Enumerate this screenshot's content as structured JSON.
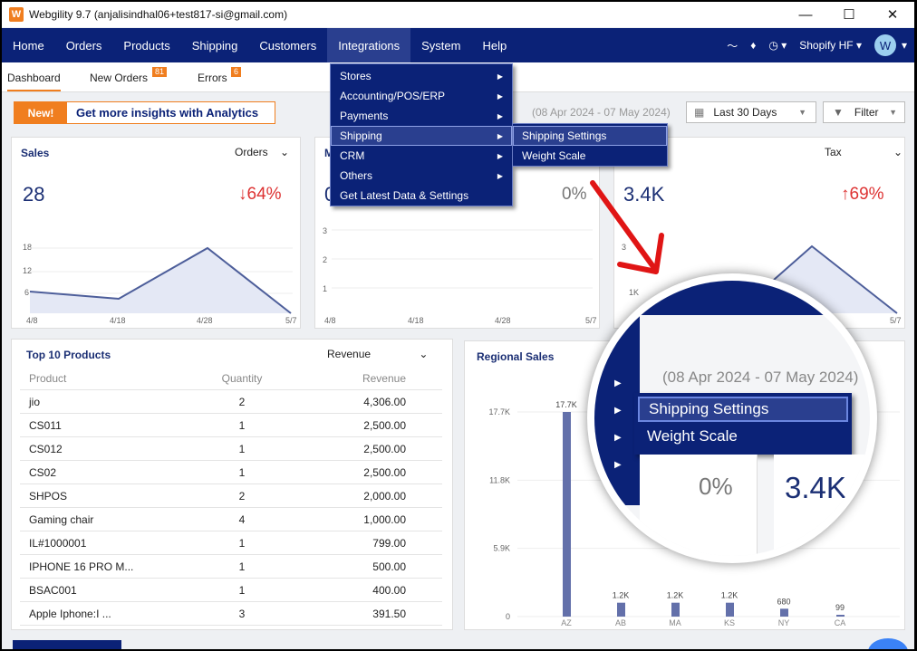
{
  "window": {
    "title": "Webgility 9.7 (anjalisindhal06+test817-si@gmail.com)",
    "logo_letter": "W"
  },
  "menubar": {
    "items": [
      "Home",
      "Orders",
      "Products",
      "Shipping",
      "Customers",
      "Integrations",
      "System",
      "Help"
    ],
    "store": "Shopify HF",
    "avatar": "W"
  },
  "tabs": {
    "dashboard": "Dashboard",
    "new_orders": "New Orders",
    "new_orders_count": "81",
    "errors": "Errors",
    "errors_count": "6"
  },
  "banner": {
    "new": "New!",
    "text": "Get more insights with Analytics"
  },
  "filters": {
    "range": "(08 Apr 2024 - 07 May 2024)",
    "period": "Last 30 Days",
    "filter": "Filter"
  },
  "integrations_menu": {
    "items": [
      "Stores",
      "Accounting/POS/ERP",
      "Payments",
      "Shipping",
      "CRM",
      "Others",
      "Get Latest Data & Settings"
    ]
  },
  "shipping_submenu": {
    "items": [
      "Shipping Settings",
      "Weight Scale"
    ]
  },
  "sales_card": {
    "title": "Sales",
    "dropdown": "Orders",
    "value": "28",
    "change": "64%",
    "yticks": [
      "18",
      "12",
      "6"
    ],
    "xticks": [
      "4/8",
      "4/18",
      "4/28",
      "5/7"
    ]
  },
  "mid_card": {
    "title_initial": "M",
    "value_initial": "0",
    "change": "0%",
    "yticks": [
      "3",
      "2",
      "1"
    ],
    "xticks": [
      "4/8",
      "4/18",
      "4/28",
      "5/7"
    ]
  },
  "tax_card": {
    "dropdown": "Tax",
    "value": "3.4K",
    "change": "69%",
    "yticks": [
      "3",
      "1K"
    ],
    "xticks": [
      "5/7"
    ]
  },
  "products": {
    "title": "Top 10 Products",
    "dropdown": "Revenue",
    "headers": [
      "Product",
      "Quantity",
      "Revenue"
    ],
    "rows": [
      [
        "jio",
        "2",
        "4,306.00"
      ],
      [
        "CS011",
        "1",
        "2,500.00"
      ],
      [
        "CS012",
        "1",
        "2,500.00"
      ],
      [
        "CS02",
        "1",
        "2,500.00"
      ],
      [
        "SHPOS",
        "2",
        "2,000.00"
      ],
      [
        "Gaming chair",
        "4",
        "1,000.00"
      ],
      [
        "IL#1000001",
        "1",
        "799.00"
      ],
      [
        "IPHONE 16 PRO M...",
        "1",
        "500.00"
      ],
      [
        "BSAC001",
        "1",
        "400.00"
      ],
      [
        "Apple Iphone:I ...",
        "3",
        "391.50"
      ]
    ]
  },
  "regional": {
    "title": "Regional Sales"
  },
  "magnifier": {
    "range": "(08 Apr 2024 - 07 May 2024)",
    "items": [
      "Shipping Settings",
      "Weight Scale"
    ],
    "pct": "0%",
    "value": "3.4K"
  },
  "chart_data": [
    {
      "type": "area",
      "title": "Sales",
      "x": [
        "4/8",
        "4/18",
        "4/28",
        "5/7"
      ],
      "values": [
        6,
        5,
        18,
        0
      ],
      "yticks": [
        6,
        12,
        18
      ]
    },
    {
      "type": "bar",
      "title": "Regional Sales",
      "categories": [
        "AZ",
        "AB",
        "MA",
        "KS",
        "NY",
        "CA"
      ],
      "values": [
        17700,
        1200,
        1200,
        1200,
        680,
        99
      ],
      "labels": [
        "17.7K",
        "1.2K",
        "1.2K",
        "1.2K",
        "680",
        "99"
      ],
      "yticks": [
        "0",
        "5.9K",
        "11.8K",
        "17.7K"
      ]
    }
  ]
}
